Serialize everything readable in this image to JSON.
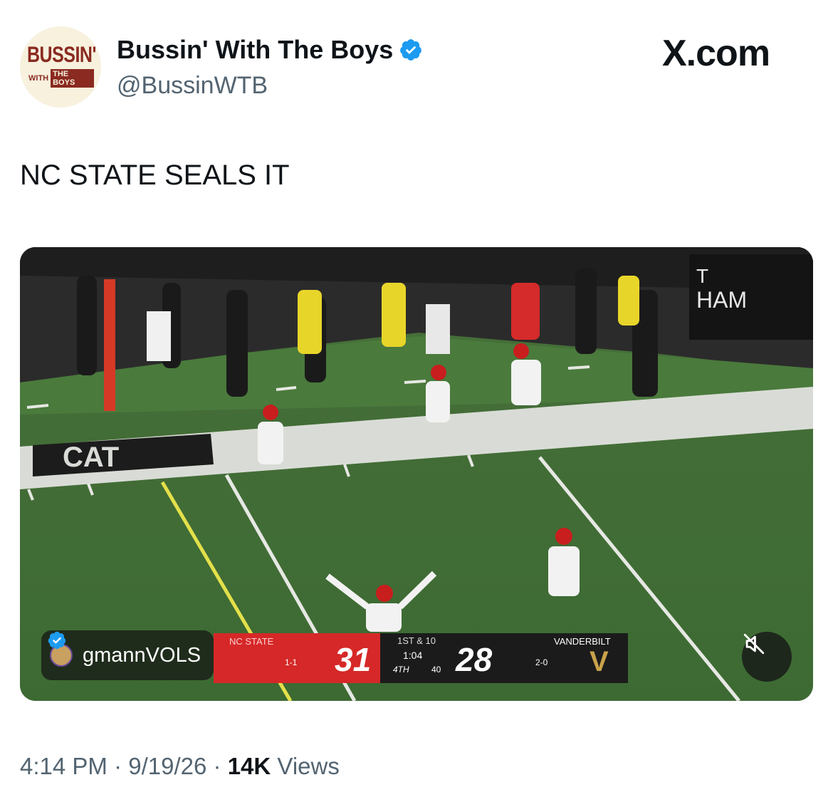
{
  "post": {
    "author": {
      "display_name": "Bussin' With The Boys",
      "handle": "@BussinWTB",
      "avatar_logo": {
        "top": "BUSSIN'",
        "with": "WITH",
        "boys": "THE BOYS"
      },
      "verified_icon": "verified-badge-icon"
    },
    "source_label": "X.com",
    "text": "NC STATE SEALS IT",
    "timestamp": "4:14 PM",
    "date": "9/19/26",
    "sep": "·",
    "views_count": "14K",
    "views_label": "Views"
  },
  "video": {
    "creator_tag": {
      "name": "gmannVOLS",
      "verified_icon": "verified-badge-icon"
    },
    "mute_icon": "muted-speaker-icon",
    "field_text": {
      "end_zone": "CAT",
      "sign": "HAM",
      "sign2": "T"
    },
    "scoreboard": {
      "home_team": "NC STATE",
      "home_record": "1-1",
      "home_score": "31",
      "down_distance": "1ST & 10",
      "clock": "1:04",
      "quarter": "4TH",
      "play_clock": "40",
      "away_score": "28",
      "away_team": "VANDERBILT",
      "away_record": "2-0",
      "away_logo": "V"
    }
  },
  "colors": {
    "verified_blue": "#1d9bf0",
    "secondary_text": "#536471",
    "brand_maroon": "#8a2a20",
    "nc_state_red": "#d62828",
    "vanderbilt_gold": "#c9a34a"
  }
}
